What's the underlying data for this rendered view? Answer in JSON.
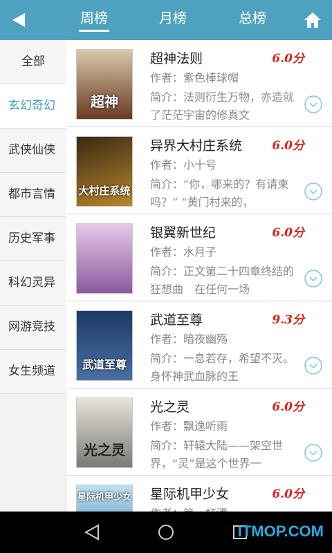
{
  "header": {
    "tabs": [
      {
        "label": "周榜",
        "active": true
      },
      {
        "label": "月榜",
        "active": false
      },
      {
        "label": "总榜",
        "active": false
      }
    ],
    "back_icon": "back-arrow-icon",
    "home_icon": "home-icon",
    "bar_color": "#4fa2bf"
  },
  "sidebar": {
    "items": [
      {
        "label": "全部"
      },
      {
        "label": "玄幻奇幻",
        "active": true
      },
      {
        "label": "武侠仙侠"
      },
      {
        "label": "都市言情"
      },
      {
        "label": "历史军事"
      },
      {
        "label": "科幻灵异"
      },
      {
        "label": "网游竞技"
      },
      {
        "label": "女生频道"
      }
    ],
    "active_color": "#3e9dbf"
  },
  "books": [
    {
      "title": "超神法则",
      "score": "6.0分",
      "author": "作者：紫色棒球帽",
      "intro": "简介：法则衍生万物，亦造就了茫茫宇宙的修真文",
      "cover_text": "超神",
      "cover_colors": [
        "#d8c9a8",
        "#6b3a24"
      ]
    },
    {
      "title": "异界大村庄系统",
      "score": "6.0分",
      "author": "作者：小十号",
      "intro": "简介：“你，哪来的？有请柬吗？” “黄门村来的，",
      "cover_text": "大村庄系统",
      "cover_colors": [
        "#3a2a14",
        "#b8872c"
      ]
    },
    {
      "title": "银翼新世纪",
      "score": "6.0分",
      "author": "作者：水月子",
      "intro": "简介：正文第二十四章终结的狂想曲　在任何一场",
      "cover_text": "",
      "cover_colors": [
        "#e6c9e8",
        "#8c5aa0"
      ]
    },
    {
      "title": "武道至尊",
      "score": "9.3分",
      "author": "作者：暗夜幽殇",
      "intro": "简介：一息若存，希望不灭。　身怀神武血脉的王",
      "cover_text": "武道至尊",
      "cover_colors": [
        "#1c3a66",
        "#4b6fa3"
      ]
    },
    {
      "title": "光之灵",
      "score": "6.0分",
      "author": "作者：飘逸听雨",
      "intro": "简介：轩辕大陆——架空世界，“灵”是这个世界一",
      "cover_text": "光之灵",
      "cover_colors": [
        "#e8e4d8",
        "#7a7a76"
      ]
    },
    {
      "title": "星际机甲少女",
      "score": "6.0分",
      "author": "作者：第一杯酒",
      "intro": "",
      "cover_text": "星际机甲少女",
      "cover_colors": [
        "#bfe0f0",
        "#3e88b8"
      ]
    }
  ],
  "bottom_nav": {
    "icons": [
      "nav-back-icon",
      "nav-home-icon",
      "nav-recents-icon"
    ],
    "watermark": "ITMOP.COM"
  },
  "colors": {
    "score": "#d7231c",
    "expand": "#7fc7d8"
  }
}
